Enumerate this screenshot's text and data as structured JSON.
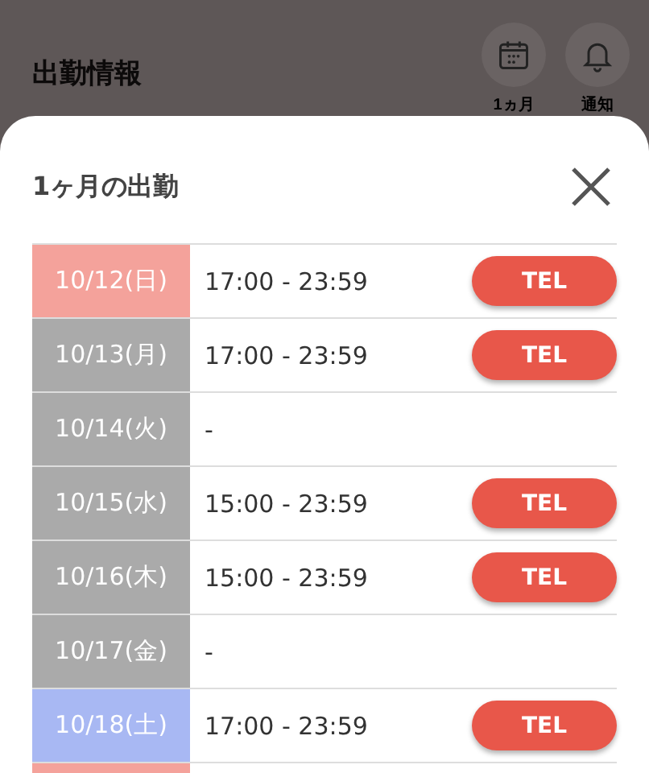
{
  "header": {
    "title": "出勤情報",
    "actions": [
      {
        "kind": "calendar",
        "label": "1ヵ月"
      },
      {
        "kind": "bell",
        "label": "通知"
      }
    ]
  },
  "sheet": {
    "title": "1ヶ月の出勤",
    "rows": [
      {
        "date": "10/12(日)",
        "color": "#f4a29b",
        "time": "17:00 - 23:59",
        "button": "TEL"
      },
      {
        "date": "10/13(月)",
        "color": "#aaaaaa",
        "time": "17:00 - 23:59",
        "button": "TEL"
      },
      {
        "date": "10/14(火)",
        "color": "#aaaaaa",
        "time": "-"
      },
      {
        "date": "10/15(水)",
        "color": "#aaaaaa",
        "time": "15:00 - 23:59",
        "button": "TEL"
      },
      {
        "date": "10/16(木)",
        "color": "#aaaaaa",
        "time": "15:00 - 23:59",
        "button": "TEL"
      },
      {
        "date": "10/17(金)",
        "color": "#aaaaaa",
        "time": "-"
      },
      {
        "date": "10/18(土)",
        "color": "#a8b8f3",
        "time": "17:00 - 23:59",
        "button": "TEL"
      },
      {
        "color": "#f4a29b"
      }
    ]
  }
}
